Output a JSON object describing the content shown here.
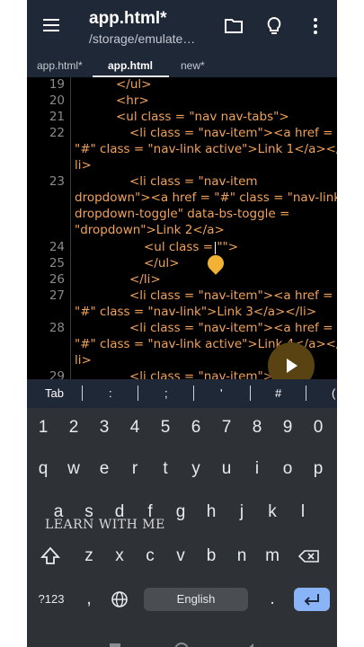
{
  "app": {
    "title": "app.html*",
    "subtitle": "/storage/emulate…"
  },
  "icons": {
    "menu": "menu-icon",
    "folder": "folder-icon",
    "lightbulb": "lightbulb-icon",
    "overflow": "more-vert-icon",
    "run": "play-icon"
  },
  "tabs": [
    {
      "label": "app.html*"
    },
    {
      "label": "app.html"
    },
    {
      "label": "new*"
    }
  ],
  "editor": {
    "lines": [
      {
        "num": "19",
        "text": "</ul>"
      },
      {
        "num": "20",
        "text": "<hr>"
      },
      {
        "num": "21",
        "text": "<ul class = \"nav nav-tabs\">"
      },
      {
        "num": "22",
        "text": "<li class = \"nav-item\"><a href =",
        "wrap": [
          "\"#\" class = \"nav-link active\">Link 1</a></",
          "li>"
        ]
      },
      {
        "num": "23",
        "text": "<li class = \"nav-item",
        "wrap": [
          "dropdown\"><a href = \"#\" class = \"nav-link",
          "dropdown-toggle\" data-bs-toggle =",
          "\"dropdown\">Link 2</a>"
        ]
      },
      {
        "num": "24",
        "text": "<ul class = \"\">"
      },
      {
        "num": "25",
        "text": "</ul>"
      },
      {
        "num": "26",
        "text": "</li>"
      },
      {
        "num": "27",
        "text": "<li class = \"nav-item\"><a href =",
        "wrap": [
          "\"#\" class = \"nav-link\">Link 3</a></li>"
        ]
      },
      {
        "num": "28",
        "text": "<li class = \"nav-item\"><a href =",
        "wrap": [
          "\"#\" class = \"nav-link active\">Link 4</a></",
          "li>"
        ]
      },
      {
        "num": "29",
        "text": "<li class = \"nav-item\">"
      }
    ]
  },
  "symbols": [
    "Tab",
    ":",
    ";",
    "'",
    "#",
    "("
  ],
  "keyboard": {
    "numbers": [
      "1",
      "2",
      "3",
      "4",
      "5",
      "6",
      "7",
      "8",
      "9",
      "0"
    ],
    "row1": [
      "q",
      "w",
      "e",
      "r",
      "t",
      "y",
      "u",
      "i",
      "o",
      "p"
    ],
    "row2": [
      "a",
      "s",
      "d",
      "f",
      "g",
      "h",
      "j",
      "k",
      "l"
    ],
    "row3": [
      "z",
      "x",
      "c",
      "v",
      "b",
      "n",
      "m"
    ],
    "mode_key": "?123",
    "comma": ",",
    "space_label": "English",
    "period": ".",
    "shift_icon": "shift-icon",
    "backspace_icon": "backspace-icon",
    "globe_icon": "globe-icon",
    "enter_icon": "enter-icon"
  },
  "watermark": "LEARN WITH ME",
  "colors": {
    "appbar": "#1f2836",
    "editor_bg": "#000000",
    "tag": "#f0a25a",
    "keyboard_bg": "#2e3135",
    "accent": "#8ab4f8",
    "cursor": "#f2b233"
  }
}
